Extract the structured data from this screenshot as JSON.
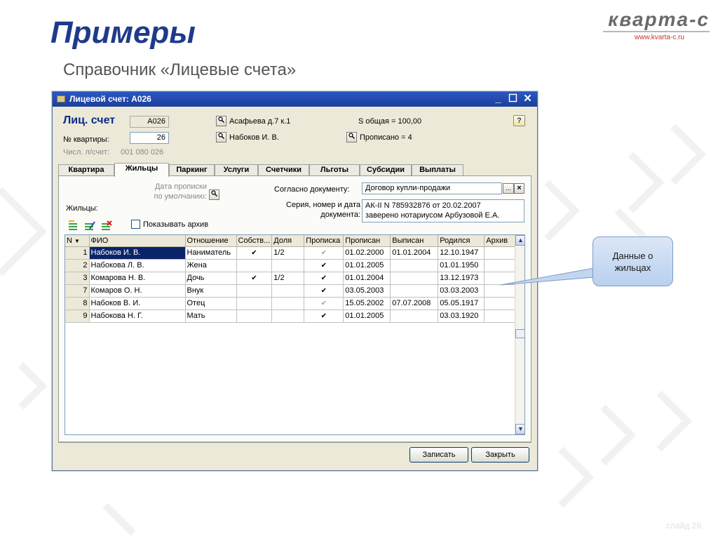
{
  "slide": {
    "title": "Примеры",
    "subtitle": "Справочник «Лицевые счета»",
    "logo_text": "кварта-с",
    "logo_url": "www.kvarta-c.ru",
    "slide_number": "слайд 26"
  },
  "window": {
    "title": "Лицевой счет: А026",
    "controls": {
      "minimize": "_",
      "maximize": "☐",
      "close": "✕"
    }
  },
  "header": {
    "account_label": "Лиц. счет",
    "account_value": "А026",
    "apartment_label": "№ квартиры:",
    "apartment_value": "26",
    "number_label": "Числ. л/счет:",
    "number_value": "001 080 026",
    "address": "Асафьева д.7 к.1",
    "owner": "Набоков И. В.",
    "area": "S общая = 100,00",
    "registered": "Прописано = 4",
    "help": "?"
  },
  "tabs": [
    "Квартира",
    "Жильцы",
    "Паркинг",
    "Услуги",
    "Счетчики",
    "Льготы",
    "Субсидии",
    "Выплаты"
  ],
  "active_tab": "Жильцы",
  "residents_panel": {
    "reg_date_label_1": "Дата прописки",
    "reg_date_label_2": "по умолчанию:",
    "doc_label": "Согласно документу:",
    "doc_value": "Договор купли-продажи",
    "serial_label_1": "Серия, номер и дата",
    "serial_label_2": "документа:",
    "serial_value_1": "АК-II N 785932876 от 20.02.2007",
    "serial_value_2": "заверено нотариусом Арбузовой Е.А.",
    "residents_label": "Жильцы:",
    "show_archive_label": "Показывать архив",
    "ellipsis": "...",
    "clear": "×"
  },
  "table": {
    "columns": [
      "N",
      "ФИО",
      "Отношение",
      "Собств...",
      "Доля",
      "Прописка",
      "Прописан",
      "Выписан",
      "Родился",
      "Архив"
    ],
    "rows": [
      {
        "n": "1",
        "fio": "Набоков И. В.",
        "relation": "Наниматель",
        "owner": "✔",
        "share": "1/2",
        "reg": "✔",
        "reg_dim": true,
        "from": "01.02.2000",
        "to": "01.01.2004",
        "born": "12.10.1947",
        "archive": ""
      },
      {
        "n": "2",
        "fio": "Набокова Л. В.",
        "relation": "Жена",
        "owner": "",
        "share": "",
        "reg": "✔",
        "reg_dim": false,
        "from": "01.01.2005",
        "to": "",
        "born": "01.01.1950",
        "archive": ""
      },
      {
        "n": "3",
        "fio": "Комарова Н. В.",
        "relation": "Дочь",
        "owner": "✔",
        "share": "1/2",
        "reg": "✔",
        "reg_dim": false,
        "from": "01.01.2004",
        "to": "",
        "born": "13.12.1973",
        "archive": ""
      },
      {
        "n": "7",
        "fio": "Комаров О. Н.",
        "relation": "Внук",
        "owner": "",
        "share": "",
        "reg": "✔",
        "reg_dim": false,
        "from": "03.05.2003",
        "to": "",
        "born": "03.03.2003",
        "archive": ""
      },
      {
        "n": "8",
        "fio": "Набоков В. И.",
        "relation": "Отец",
        "owner": "",
        "share": "",
        "reg": "✔",
        "reg_dim": true,
        "from": "15.05.2002",
        "to": "07.07.2008",
        "born": "05.05.1917",
        "archive": ""
      },
      {
        "n": "9",
        "fio": "Набокова Н. Г.",
        "relation": "Мать",
        "owner": "",
        "share": "",
        "reg": "✔",
        "reg_dim": false,
        "from": "01.01.2005",
        "to": "",
        "born": "03.03.1920",
        "archive": ""
      }
    ]
  },
  "buttons": {
    "save": "Записать",
    "close": "Закрыть"
  },
  "callout": "Данные о жильцах",
  "colors": {
    "title": "#1f3a8c",
    "titlebar": "#2a57c4",
    "selection": "#0a246a",
    "callout": "#c9daf2"
  }
}
